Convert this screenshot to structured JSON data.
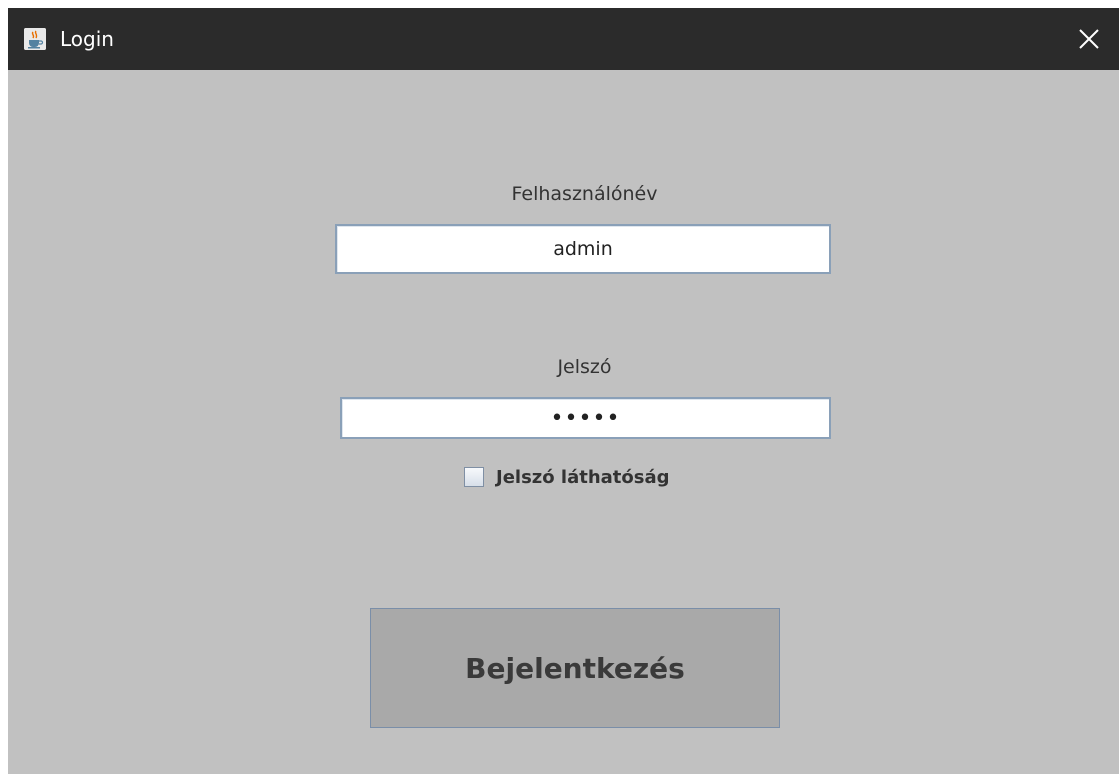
{
  "window": {
    "title": "Login",
    "app_icon": "java-cup-icon",
    "close_icon": "close-icon",
    "background": "#c1c1c1",
    "titlebar_color": "#2b2b2b"
  },
  "form": {
    "username_label": "Felhasználónév",
    "username_value": "admin",
    "password_label": "Jelszó",
    "password_value": "•••••",
    "show_password_label": "Jelszó láthatóság",
    "show_password_checked": false,
    "login_button_label": "Bejelentkezés"
  }
}
